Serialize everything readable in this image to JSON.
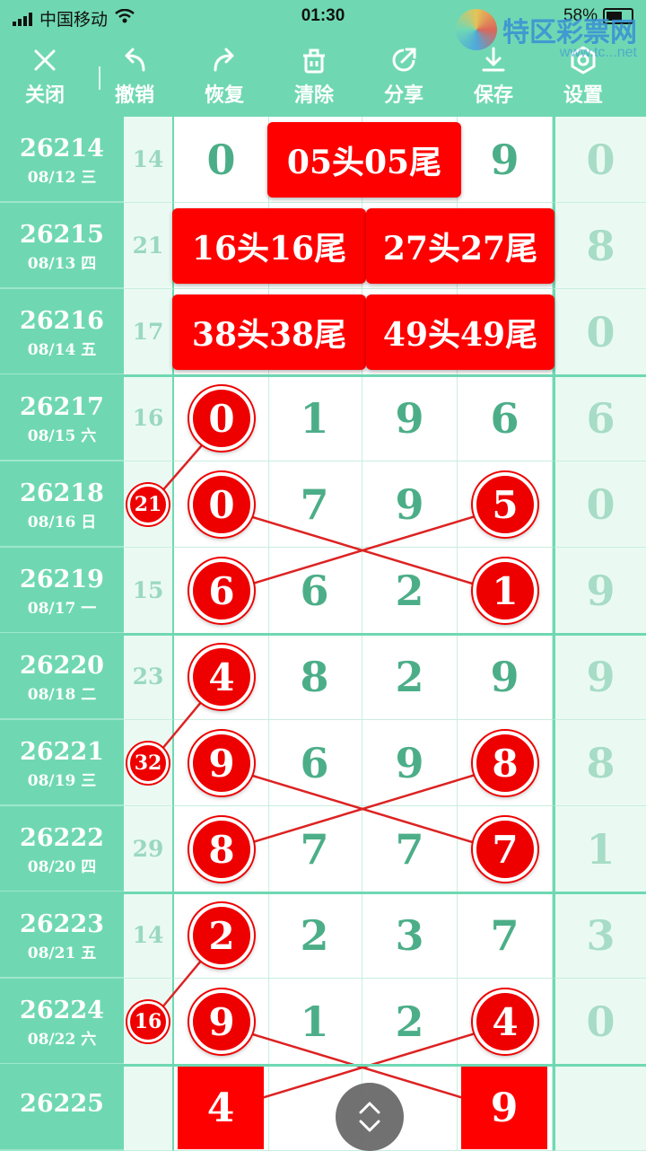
{
  "status": {
    "carrier": "中国移动",
    "time": "01:30",
    "battery": "58%"
  },
  "logo": {
    "name": "特区彩票网",
    "url": "www.tc...net"
  },
  "toolbar": [
    {
      "label": "关闭",
      "icon": "close-icon"
    },
    {
      "label": "撤销",
      "icon": "undo-icon"
    },
    {
      "label": "恢复",
      "icon": "redo-icon"
    },
    {
      "label": "清除",
      "icon": "trash-icon"
    },
    {
      "label": "分享",
      "icon": "share-icon"
    },
    {
      "label": "保存",
      "icon": "download-icon"
    },
    {
      "label": "设置",
      "icon": "settings-icon"
    }
  ],
  "rows": [
    {
      "issue": "26214",
      "date": "08/12 三",
      "sum": "14",
      "digits": [
        "0",
        "",
        "",
        "9"
      ],
      "last": "0"
    },
    {
      "issue": "26215",
      "date": "08/13 四",
      "sum": "21",
      "digits": [
        "",
        "",
        "",
        ""
      ],
      "last": "8"
    },
    {
      "issue": "26216",
      "date": "08/14 五",
      "sum": "17",
      "digits": [
        "",
        "",
        "",
        ""
      ],
      "last": "0"
    },
    {
      "issue": "26217",
      "date": "08/15 六",
      "sum": "16",
      "digits": [
        "0",
        "1",
        "9",
        "6"
      ],
      "last": "6"
    },
    {
      "issue": "26218",
      "date": "08/16 日",
      "sum": "",
      "digits": [
        "0",
        "7",
        "9",
        "5"
      ],
      "last": "0"
    },
    {
      "issue": "26219",
      "date": "08/17 一",
      "sum": "15",
      "digits": [
        "6",
        "6",
        "2",
        "1"
      ],
      "last": "9"
    },
    {
      "issue": "26220",
      "date": "08/18 二",
      "sum": "23",
      "digits": [
        "4",
        "8",
        "2",
        "9"
      ],
      "last": "9"
    },
    {
      "issue": "26221",
      "date": "08/19 三",
      "sum": "",
      "digits": [
        "9",
        "6",
        "9",
        "8"
      ],
      "last": "8"
    },
    {
      "issue": "26222",
      "date": "08/20 四",
      "sum": "29",
      "digits": [
        "8",
        "7",
        "7",
        "7"
      ],
      "last": "1"
    },
    {
      "issue": "26223",
      "date": "08/21 五",
      "sum": "14",
      "digits": [
        "2",
        "2",
        "3",
        "7"
      ],
      "last": "3"
    },
    {
      "issue": "26224",
      "date": "08/22 六",
      "sum": "",
      "digits": [
        "9",
        "1",
        "2",
        "4"
      ],
      "last": "0"
    },
    {
      "issue": "26225",
      "date": "",
      "sum": "",
      "digits": [
        "4",
        "",
        "",
        "9"
      ],
      "last": ""
    }
  ],
  "banners": [
    "05头05尾",
    "16头16尾",
    "27头27尾",
    "38头38尾",
    "49头49尾"
  ],
  "small_balls": [
    "21",
    "32",
    "16"
  ]
}
